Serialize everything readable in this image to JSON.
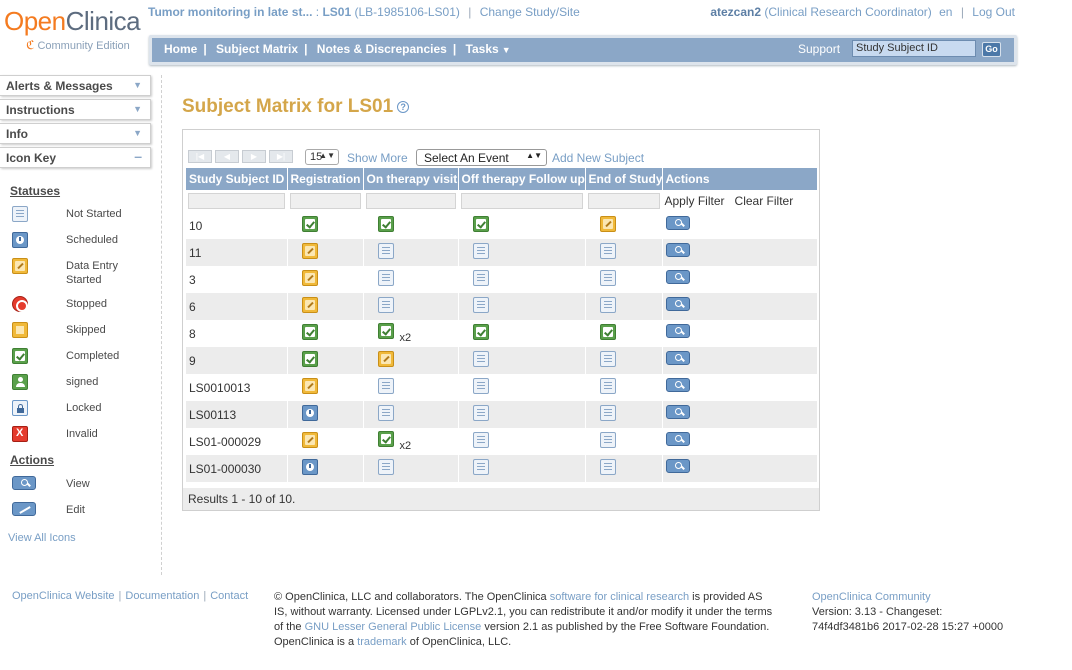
{
  "logo": {
    "open": "Open",
    "clinica": "Clinica",
    "sub": "Community Edition"
  },
  "header": {
    "study_name": "Tumor monitoring in late st...",
    "study_sep": " : ",
    "study_code": "LS01",
    "protocol": "(LB-1985106-LS01)",
    "change_study": "Change Study/Site",
    "user": "atezcan2",
    "role": "(Clinical Research Coordinator)",
    "lang": "en",
    "logout": "Log Out"
  },
  "nav": {
    "items": [
      "Home",
      "Subject Matrix",
      "Notes & Discrepancies",
      "Tasks"
    ],
    "support": "Support",
    "search_value": "Study Subject ID",
    "go": "Go"
  },
  "sidebar": {
    "panels": [
      "Alerts & Messages",
      "Instructions",
      "Info",
      "Icon Key"
    ],
    "statuses_heading": "Statuses",
    "statuses": [
      {
        "icon": "not-started",
        "label": "Not Started"
      },
      {
        "icon": "scheduled",
        "label": "Scheduled"
      },
      {
        "icon": "data-entry-started",
        "label": "Data Entry Started"
      },
      {
        "icon": "stopped",
        "label": "Stopped"
      },
      {
        "icon": "skipped",
        "label": "Skipped"
      },
      {
        "icon": "completed",
        "label": "Completed"
      },
      {
        "icon": "signed",
        "label": "signed"
      },
      {
        "icon": "locked",
        "label": "Locked"
      },
      {
        "icon": "invalid",
        "label": "Invalid"
      }
    ],
    "actions_heading": "Actions",
    "actions": [
      {
        "icon": "view",
        "label": "View"
      },
      {
        "icon": "edit",
        "label": "Edit"
      }
    ],
    "view_all": "View All Icons"
  },
  "main": {
    "title": "Subject Matrix for LS01",
    "page_size": "15",
    "show_more": "Show More",
    "event_select": "Select An Event",
    "add_subject": "Add New Subject",
    "columns": [
      "Study Subject ID",
      "Registration",
      "On therapy visit",
      "Off therapy Follow up",
      "End of Study",
      "Actions"
    ],
    "apply_filter": "Apply Filter",
    "clear_filter": "Clear Filter",
    "rows": [
      {
        "id": "10",
        "c": [
          "completed",
          "completed",
          "completed",
          "data-entry-started"
        ],
        "x2": [
          false,
          false,
          false,
          false
        ],
        "action_offset": 0
      },
      {
        "id": "11",
        "c": [
          "data-entry-started",
          "not-started",
          "not-started",
          "not-started"
        ],
        "x2": [
          false,
          false,
          false,
          false
        ]
      },
      {
        "id": "3",
        "c": [
          "data-entry-started",
          "not-started",
          "not-started",
          "not-started"
        ],
        "x2": [
          false,
          false,
          false,
          false
        ]
      },
      {
        "id": "6",
        "c": [
          "data-entry-started",
          "not-started",
          "not-started",
          "not-started"
        ],
        "x2": [
          false,
          false,
          false,
          false
        ]
      },
      {
        "id": "8",
        "c": [
          "completed",
          "completed",
          "completed",
          "completed"
        ],
        "x2": [
          false,
          true,
          false,
          false
        ]
      },
      {
        "id": "9",
        "c": [
          "completed",
          "data-entry-started",
          "not-started",
          "not-started"
        ],
        "x2": [
          false,
          false,
          false,
          false
        ]
      },
      {
        "id": "LS0010013",
        "c": [
          "data-entry-started",
          "not-started",
          "not-started",
          "not-started"
        ],
        "x2": [
          false,
          false,
          false,
          false
        ]
      },
      {
        "id": "LS00113",
        "c": [
          "scheduled",
          "not-started",
          "not-started",
          "not-started"
        ],
        "x2": [
          false,
          false,
          false,
          false
        ]
      },
      {
        "id": "LS01-000029",
        "c": [
          "data-entry-started",
          "completed",
          "not-started",
          "not-started"
        ],
        "x2": [
          false,
          true,
          false,
          false
        ]
      },
      {
        "id": "LS01-000030",
        "c": [
          "scheduled",
          "not-started",
          "not-started",
          "not-started"
        ],
        "x2": [
          false,
          false,
          false,
          false
        ]
      }
    ],
    "x2_label": "x2",
    "results": "Results 1 - 10 of 10."
  },
  "footer": {
    "links": [
      "OpenClinica Website",
      "Documentation",
      "Contact"
    ],
    "text_1": "© OpenClinica, LLC and collaborators. The OpenClinica ",
    "text_link_1": "software for clinical research",
    "text_2": " is provided AS IS, without warranty. Licensed under LGPLv2.1, you can redistribute it and/or modify it under the terms of the ",
    "text_link_2": "GNU Lesser General Public License",
    "text_3": " version 2.1 as published by the Free Software Foundation. OpenClinica is a ",
    "text_link_3": "trademark",
    "text_4": " of OpenClinica, LLC.",
    "community": "OpenClinica Community",
    "version": "Version: 3.13 - Changeset:",
    "changeset": "74f4df3481b6 2017-02-28 15:27 +0000"
  }
}
